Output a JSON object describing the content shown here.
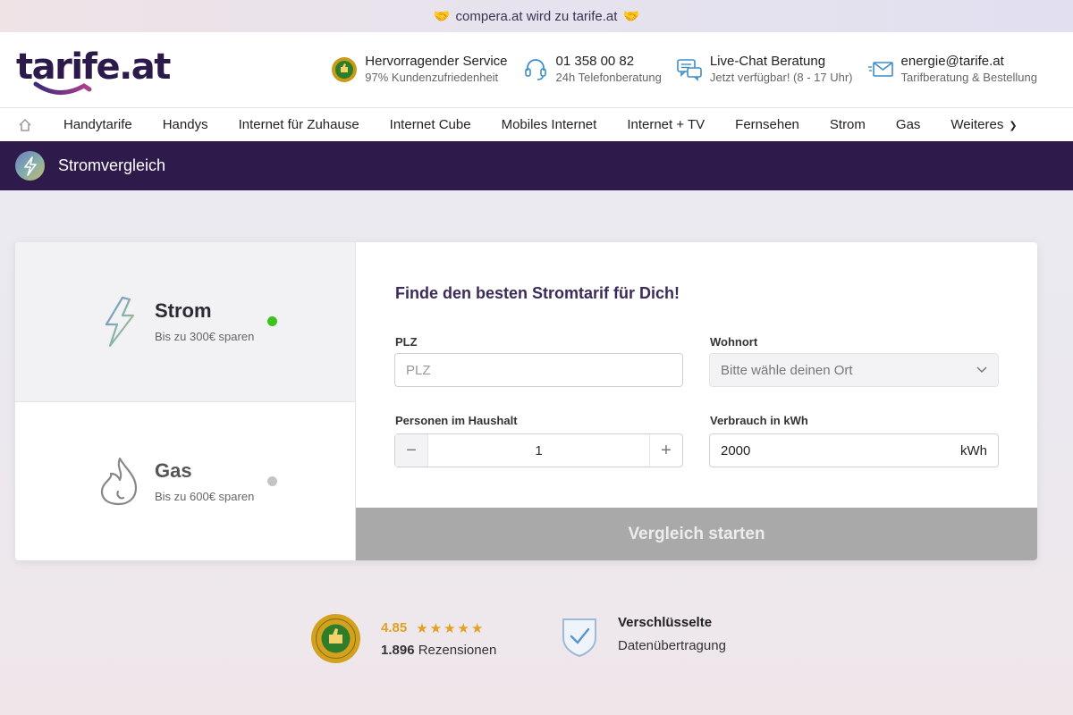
{
  "banner": {
    "icon": "handshake-icon",
    "text": "compera.at wird zu tarife.at"
  },
  "header": {
    "logo": "tarife.at",
    "contacts": [
      {
        "icon": "award-seal-icon",
        "title": "Hervorragender Service",
        "subtitle": "97% Kundenzufriedenheit"
      },
      {
        "icon": "headset-icon",
        "title": "01 358 00 82",
        "subtitle": "24h Telefonberatung"
      },
      {
        "icon": "chat-icon",
        "title": "Live-Chat Beratung",
        "subtitle": "Jetzt verfügbar! (8 - 17 Uhr)"
      },
      {
        "icon": "mail-icon",
        "title": "energie@tarife.at",
        "subtitle": "Tarifberatung & Bestellung"
      }
    ]
  },
  "nav": {
    "items": [
      "Handytarife",
      "Handys",
      "Internet für Zuhause",
      "Internet Cube",
      "Mobiles Internet",
      "Internet + TV",
      "Fernsehen",
      "Strom",
      "Gas",
      "Weiteres"
    ]
  },
  "section": {
    "icon": "lightning-icon",
    "title": "Stromvergleich"
  },
  "energy_options": [
    {
      "name": "Strom",
      "subtitle": "Bis zu 300€ sparen",
      "icon": "lightning-icon",
      "selected": true,
      "dot_color": "#3cc21f"
    },
    {
      "name": "Gas",
      "subtitle": "Bis zu 600€ sparen",
      "icon": "flame-icon",
      "selected": false,
      "dot_color": "#c4c4c4"
    }
  ],
  "form": {
    "title": "Finde den besten Stromtarif für Dich!",
    "plz_label": "PLZ",
    "plz_placeholder": "PLZ",
    "wohnort_label": "Wohnort",
    "wohnort_value": "Bitte wähle deinen Ort",
    "personen_label": "Personen im Haushalt",
    "personen_value": "1",
    "minus": "−",
    "plus": "+",
    "verbrauch_label": "Verbrauch in kWh",
    "verbrauch_value": "2000",
    "verbrauch_unit": "kWh",
    "submit": "Vergleich starten"
  },
  "trust": {
    "score": "4.85",
    "stars": "★★★★★",
    "reviews_count": "1.896",
    "reviews_label": "Rezensionen",
    "secure_title": "Verschlüsselte",
    "secure_subtitle": "Datenübertragung"
  },
  "colors": {
    "purple": "#2e1b4b",
    "accent_gold": "#e1a21e",
    "green_dot": "#3cc21f",
    "submit_gray": "#a9a9a9"
  }
}
